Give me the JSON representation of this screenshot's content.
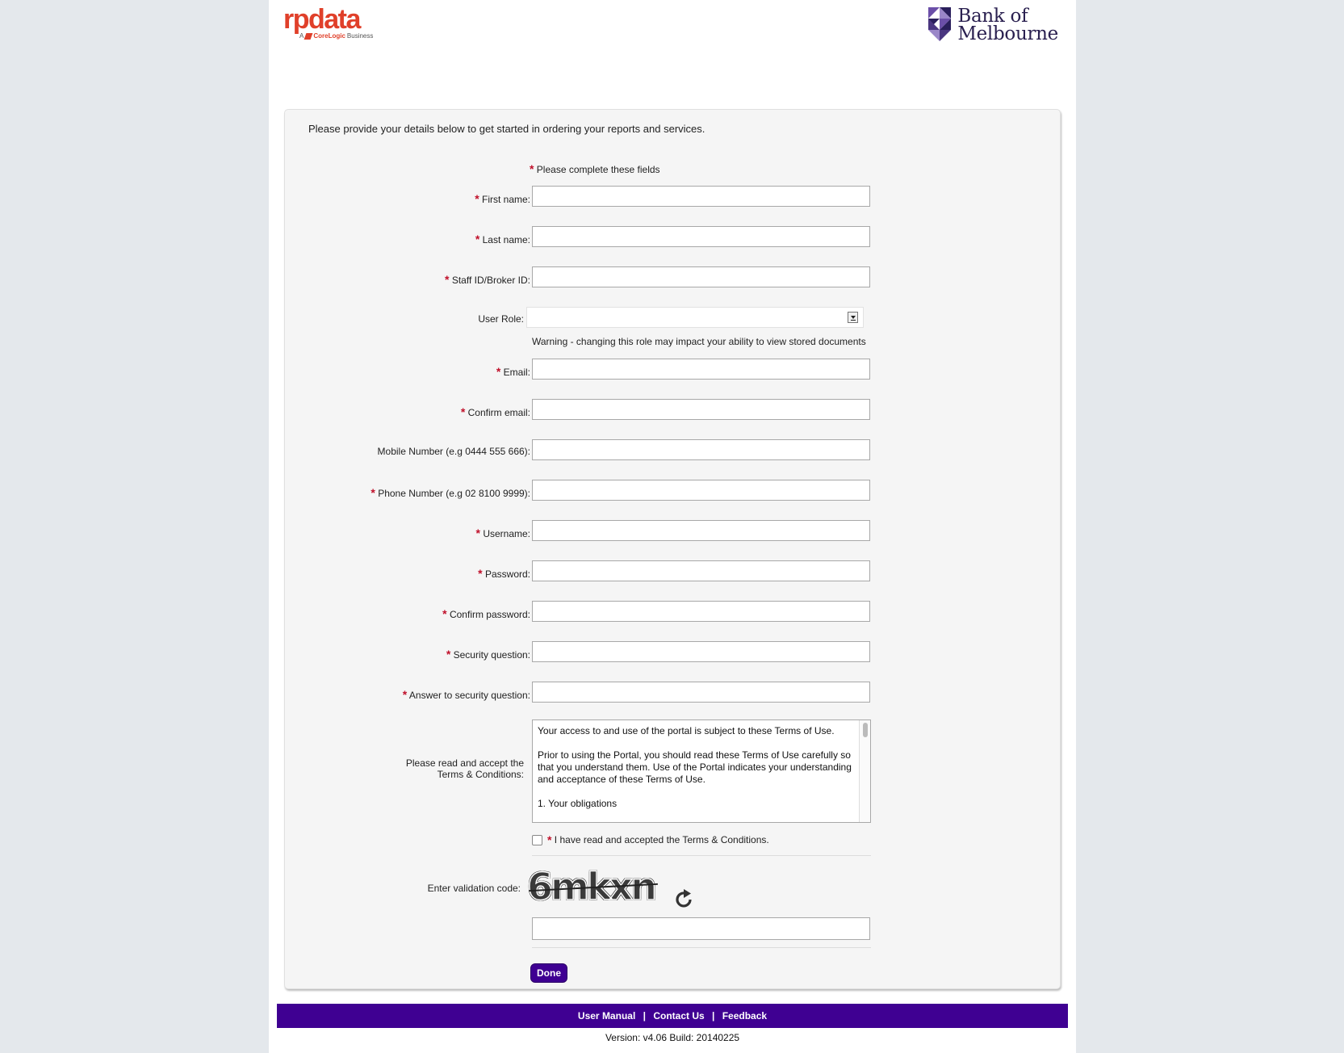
{
  "header": {
    "rpdata_logo_text": "rpdata",
    "rpdata_tagline_prefix": "A",
    "rpdata_tagline_brand": "CoreLogic",
    "rpdata_tagline_suffix": "Business",
    "bank_logo_line1": "Bank of",
    "bank_logo_line2": "Melbourne"
  },
  "form": {
    "intro": "Please provide your details below to get started in ordering your reports and services.",
    "required_asterisk": "*",
    "required_note": "Please complete these fields",
    "fields": {
      "first_name": "First name:",
      "last_name": "Last name:",
      "staff_id": "Staff ID/Broker ID:",
      "user_role": "User Role:",
      "email": "Email:",
      "confirm_email": "Confirm email:",
      "mobile": "Mobile Number (e.g 0444 555 666):",
      "phone": "Phone Number (e.g 02 8100 9999):",
      "username": "Username:",
      "password": "Password:",
      "confirm_password": "Confirm password:",
      "security_question": "Security question:",
      "security_answer": "Answer to security question:"
    },
    "role_warning": "Warning - changing this role may impact your ability to view stored documents",
    "terms_label_line1": "Please read and accept the",
    "terms_label_line2": "Terms & Conditions:",
    "terms_text": [
      "Your access to and use of the portal is subject to these Terms of Use.",
      "Prior to using the Portal, you should read these Terms of Use carefully so that you understand them. Use of the Portal indicates your understanding and acceptance of these Terms of Use.",
      "1. Your obligations"
    ],
    "accept_terms_label": "I have read and accepted the Terms & Conditions.",
    "captcha_label": "Enter validation code:",
    "captcha_code": "6mkxn",
    "submit_label": "Done"
  },
  "footer": {
    "links": [
      "User Manual",
      "Contact Us",
      "Feedback"
    ],
    "separator": "|",
    "version": "Version: v4.06 Build: 20140225"
  },
  "colors": {
    "brand_purple": "#3f0092",
    "rpdata_red": "#e0402a",
    "required_red": "#c0102a"
  },
  "icons": [
    "refresh-icon",
    "dropdown-arrow-icon",
    "bank-of-melbourne-logo-icon"
  ]
}
